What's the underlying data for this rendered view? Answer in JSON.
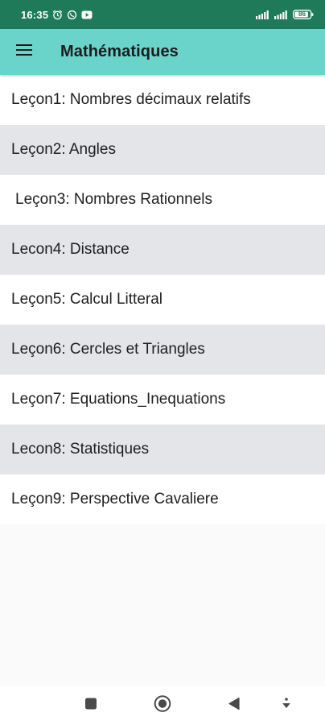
{
  "status_bar": {
    "time": "16:35",
    "battery_level": "86",
    "icons": [
      "alarm-icon",
      "whatsapp-icon",
      "youtube-icon",
      "signal-icon",
      "signal-icon",
      "battery-icon"
    ]
  },
  "app_bar": {
    "title": "Mathématiques",
    "menu_icon": "hamburger-menu-icon",
    "background_color": "#6ad3ca"
  },
  "lessons": [
    "Leçon1: Nombres décimaux relatifs",
    "Leçon2: Angles",
    "Leçon3: Nombres Rationnels",
    "Lecon4: Distance",
    "Leçon5: Calcul Litteral",
    "Leçon6: Cercles et Triangles",
    "Leçon7: Equations_Inequations",
    "Lecon8: Statistiques",
    "Leçon9: Perspective Cavaliere"
  ],
  "nav_bar": {
    "icons": [
      "recents-square-icon",
      "home-circle-icon",
      "back-triangle-icon",
      "notification-pull-icon"
    ]
  },
  "colors": {
    "status_bar": "#1e7a58",
    "row_alt": "#e4e5e9",
    "row": "#ffffff"
  }
}
